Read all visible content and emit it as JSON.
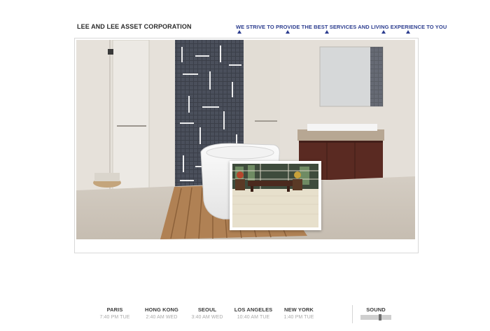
{
  "header": {
    "company": "LEE AND LEE ASSET CORPORATION",
    "tagline": "WE STRIVE TO PROVIDE THE BEST SERVICES AND LIVING EXPERIENCE TO YOU",
    "accent_color": "#2c3d8f"
  },
  "gallery": {
    "main_image": "bathroom-interior-photo",
    "inset_image": "lobby-lounge-photo"
  },
  "world_clocks": [
    {
      "city": "PARIS",
      "time": "7:40 PM TUE"
    },
    {
      "city": "HONG KONG",
      "time": "2:40 AM WED"
    },
    {
      "city": "SEOUL",
      "time": "3:40 AM WED"
    },
    {
      "city": "LOS ANGELES",
      "time": "10:40 AM TUE"
    },
    {
      "city": "NEW YORK",
      "time": "1:40 PM TUE"
    }
  ],
  "sound": {
    "label": "SOUND",
    "level": 0.65
  }
}
